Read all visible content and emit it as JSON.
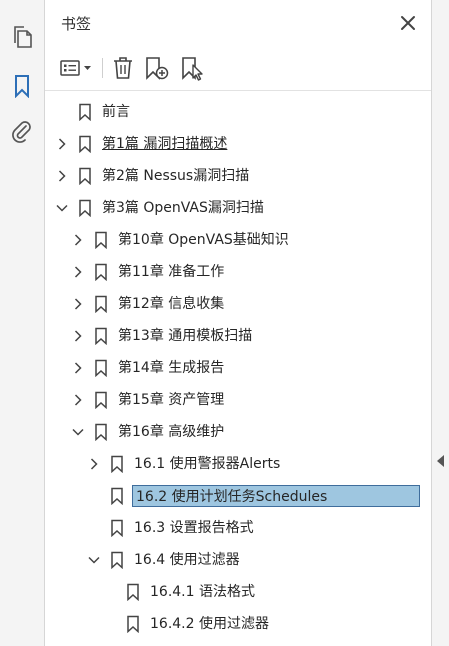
{
  "panel": {
    "title": "书签"
  },
  "icons": {
    "rail": [
      "copy-pages-icon",
      "bookmark-icon",
      "paperclip-icon"
    ],
    "toolbar": [
      "options-list-icon",
      "trash-icon",
      "new-bookmark-icon",
      "bookmark-from-selection-icon"
    ],
    "close": "close-icon"
  },
  "colors": {
    "accent": "#2d6fb7",
    "selection_bg": "#9ec6e0",
    "selection_border": "#3f6d9c"
  },
  "bookmarks": [
    {
      "label": "前言",
      "level": 0,
      "expander": "none"
    },
    {
      "label": "第1篇 漏洞扫描概述",
      "level": 0,
      "expander": "collapsed",
      "underlined": true
    },
    {
      "label": "第2篇 Nessus漏洞扫描",
      "level": 0,
      "expander": "collapsed"
    },
    {
      "label": "第3篇 OpenVAS漏洞扫描",
      "level": 0,
      "expander": "expanded"
    },
    {
      "label": "第10章 OpenVAS基础知识",
      "level": 1,
      "expander": "collapsed"
    },
    {
      "label": "第11章 准备工作",
      "level": 1,
      "expander": "collapsed"
    },
    {
      "label": "第12章 信息收集",
      "level": 1,
      "expander": "collapsed"
    },
    {
      "label": "第13章 通用模板扫描",
      "level": 1,
      "expander": "collapsed"
    },
    {
      "label": "第14章 生成报告",
      "level": 1,
      "expander": "collapsed"
    },
    {
      "label": "第15章 资产管理",
      "level": 1,
      "expander": "collapsed"
    },
    {
      "label": "第16章 高级维护",
      "level": 1,
      "expander": "expanded"
    },
    {
      "label": "16.1 使用警报器Alerts",
      "level": 2,
      "expander": "collapsed"
    },
    {
      "label": "16.2 使用计划任务Schedules",
      "level": 2,
      "expander": "none",
      "selected": true
    },
    {
      "label": "16.3 设置报告格式",
      "level": 2,
      "expander": "none"
    },
    {
      "label": "16.4 使用过滤器",
      "level": 2,
      "expander": "expanded"
    },
    {
      "label": "16.4.1 语法格式",
      "level": 3,
      "expander": "none"
    },
    {
      "label": "16.4.2 使用过滤器",
      "level": 3,
      "expander": "none"
    }
  ]
}
